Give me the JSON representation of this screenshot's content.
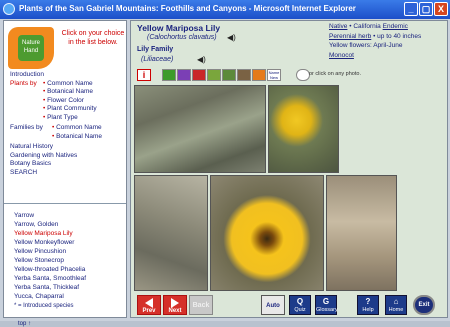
{
  "window": {
    "title": "Plants of the San Gabriel Mountains: Foothills and Canyons - Microsoft Internet Explorer",
    "buttons": [
      "_",
      "▢",
      "X"
    ]
  },
  "logo": {
    "text": "Nature Hand"
  },
  "left": {
    "instruction": "Click on your choice in the list below.",
    "nav": {
      "introduction": "Introduction",
      "plants_by_label": "Plants by",
      "plants_by": [
        "Common Name",
        "Botanical Name",
        "Flower Color",
        "Plant Community",
        "Plant Type"
      ],
      "families_by_label": "Families by",
      "families_by": [
        "Common Name",
        "Botanical Name"
      ],
      "natural_history": "Natural History",
      "gardening": "Gardening with Natives",
      "botany_basics": "Botany Basics",
      "search": "SEARCH"
    },
    "species": [
      "Yarrow",
      "Yarrow, Golden",
      "Yellow Mariposa Lily",
      "Yellow Monkeyflower",
      "Yellow Pincushion",
      "Yellow Stonecrop",
      "Yellow-throated Phacelia",
      "Yerba Santa, Smoothleaf",
      "Yerba Santa, Thickleaf",
      "Yucca, Chaparral"
    ],
    "selected_species": "Yellow Mariposa Lily",
    "introduced_note": "* = Introduced species",
    "top_link": "top"
  },
  "plant": {
    "common_name": "Yellow Mariposa Lily",
    "latin_name": "(Calochortus clavatus)",
    "family": "Lily Family",
    "family_latin": "(Liliaceae)",
    "native": "Native",
    "dot1": "•",
    "california": "California",
    "endemic": "Endemic",
    "perennial": "Perennial herb",
    "height": "• up to 40 inches",
    "flowers": "Yellow flowers: April-June",
    "monocot": "Monocot"
  },
  "icons_note": "or click on any photo.",
  "buttons": {
    "prev": "Prev",
    "next": "Next",
    "back": "Back",
    "auto": "Auto",
    "quiz": "Quiz",
    "glossary": "Glossary",
    "help": "Help",
    "home": "Home",
    "exit": "Exit"
  }
}
